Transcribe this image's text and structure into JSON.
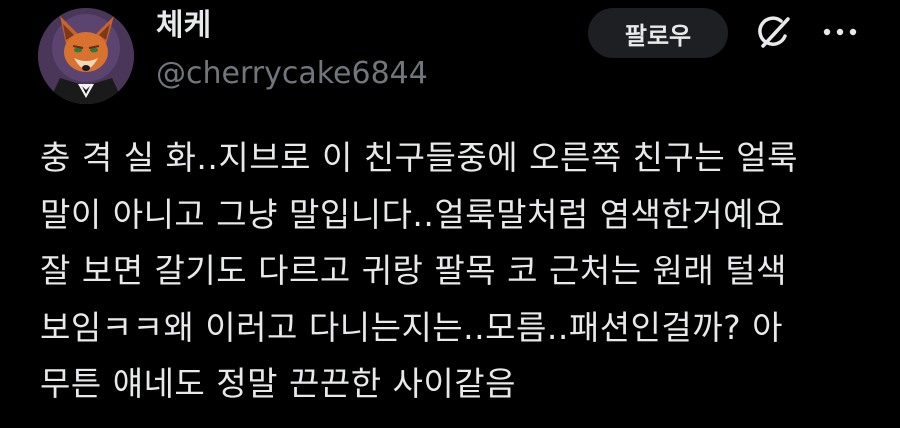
{
  "user": {
    "display_name": "체케",
    "handle": "@cherrycake6844",
    "avatar_icon": "fox-character-avatar"
  },
  "actions": {
    "follow_label": "팔로우",
    "grok_icon": "grok-icon",
    "more_icon": "more-icon"
  },
  "tweet": {
    "lines": [
      "충 격 실 화..지브로 이 친구들중에 오른쪽 친구는 얼룩",
      "말이 아니고 그냥 말입니다..얼룩말처럼 염색한거예요",
      "잘 보면 갈기도 다르고 귀랑 팔목 코 근처는 원래 털색",
      "보임ㅋㅋ왜 이러고 다니는지는..모름..패션인걸까? 아",
      "무튼 얘네도 정말 끈끈한 사이같음"
    ]
  },
  "colors": {
    "background": "#000000",
    "text_primary": "#e7e9ea",
    "text_secondary": "#71767b",
    "button_bg": "#1d1f23"
  }
}
